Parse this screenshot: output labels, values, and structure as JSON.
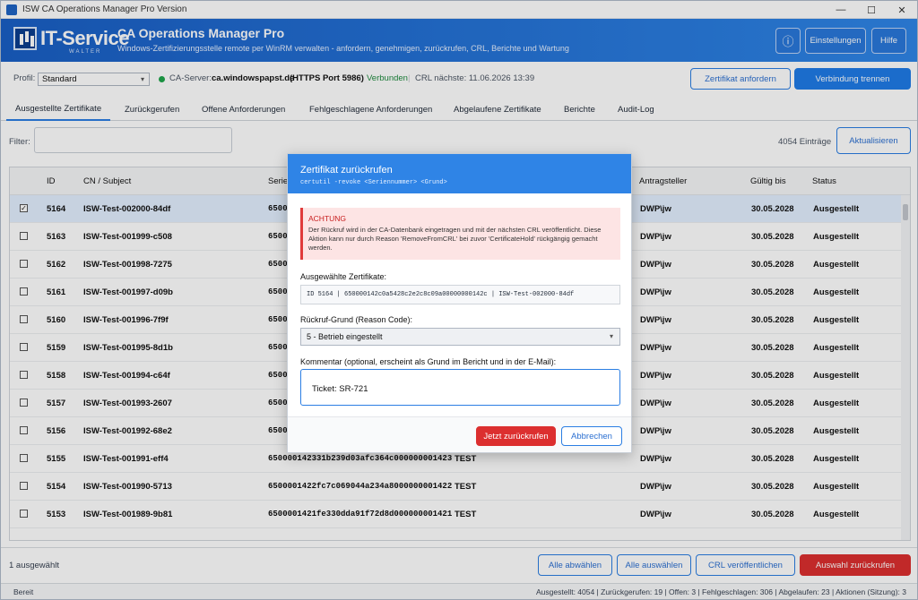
{
  "window": {
    "title": "ISW CA Operations Manager Pro Version",
    "min": "—",
    "max": "☐",
    "close": "✕"
  },
  "header": {
    "logo_text": "IT-Service",
    "logo_sub": "WALTER",
    "app_title": "CA Operations Manager Pro",
    "subtitle": "Windows-Zertifizierungsstelle remote per WinRM verwalten - anfordern, genehmigen, zurückrufen, CRL, Berichte und Wartung",
    "info_icon": "ⓘ",
    "settings_label": "Einstellungen",
    "help_label": "Hilfe"
  },
  "status": {
    "profile_label": "Profil:",
    "profile_value": "Standard",
    "ca_label": "CA-Server:",
    "ca_host": "ca.windowspapst.de",
    "ca_port": "(HTTPS Port 5986)",
    "connected": "Verbunden",
    "crl_next": "CRL nächste: 11.06.2026 13:39",
    "request_cert": "Zertifikat anfordern",
    "disconnect": "Verbindung trennen"
  },
  "tabs": [
    "Ausgestellte Zertifikate",
    "Zurückgerufen",
    "Offene Anforderungen",
    "Fehlgeschlagene Anforderungen",
    "Abgelaufene Zertifikate",
    "Berichte",
    "Audit-Log"
  ],
  "filter": {
    "label": "Filter:",
    "value": "",
    "count": "4054 Einträge",
    "refresh": "Aktualisieren"
  },
  "table": {
    "columns": [
      "ID",
      "CN / Subject",
      "Serie",
      "Antragsteller",
      "Gültig bis",
      "Status"
    ],
    "rows": [
      {
        "checked": "✓",
        "id": "5164",
        "cn": "ISW-Test-002000-84df",
        "serial": "65000",
        "template": "",
        "requester": "DWP\\jw",
        "valid": "30.05.2028",
        "status": "Ausgestellt"
      },
      {
        "checked": "",
        "id": "5163",
        "cn": "ISW-Test-001999-c508",
        "serial": "65000",
        "template": "",
        "requester": "DWP\\jw",
        "valid": "30.05.2028",
        "status": "Ausgestellt"
      },
      {
        "checked": "",
        "id": "5162",
        "cn": "ISW-Test-001998-7275",
        "serial": "65000",
        "template": "",
        "requester": "DWP\\jw",
        "valid": "30.05.2028",
        "status": "Ausgestellt"
      },
      {
        "checked": "",
        "id": "5161",
        "cn": "ISW-Test-001997-d09b",
        "serial": "65000",
        "template": "",
        "requester": "DWP\\jw",
        "valid": "30.05.2028",
        "status": "Ausgestellt"
      },
      {
        "checked": "",
        "id": "5160",
        "cn": "ISW-Test-001996-7f9f",
        "serial": "65000",
        "template": "",
        "requester": "DWP\\jw",
        "valid": "30.05.2028",
        "status": "Ausgestellt"
      },
      {
        "checked": "",
        "id": "5159",
        "cn": "ISW-Test-001995-8d1b",
        "serial": "65000",
        "template": "",
        "requester": "DWP\\jw",
        "valid": "30.05.2028",
        "status": "Ausgestellt"
      },
      {
        "checked": "",
        "id": "5158",
        "cn": "ISW-Test-001994-c64f",
        "serial": "65000",
        "template": "",
        "requester": "DWP\\jw",
        "valid": "30.05.2028",
        "status": "Ausgestellt"
      },
      {
        "checked": "",
        "id": "5157",
        "cn": "ISW-Test-001993-2607",
        "serial": "65000",
        "template": "",
        "requester": "DWP\\jw",
        "valid": "30.05.2028",
        "status": "Ausgestellt"
      },
      {
        "checked": "",
        "id": "5156",
        "cn": "ISW-Test-001992-68e2",
        "serial": "65000",
        "template": "",
        "requester": "DWP\\jw",
        "valid": "30.05.2028",
        "status": "Ausgestellt"
      },
      {
        "checked": "",
        "id": "5155",
        "cn": "ISW-Test-001991-eff4",
        "serial": "650000142331b239d03afc364c000000001423",
        "template": "TEST",
        "requester": "DWP\\jw",
        "valid": "30.05.2028",
        "status": "Ausgestellt"
      },
      {
        "checked": "",
        "id": "5154",
        "cn": "ISW-Test-001990-5713",
        "serial": "6500001422fc7c069044a234a8000000001422",
        "template": "TEST",
        "requester": "DWP\\jw",
        "valid": "30.05.2028",
        "status": "Ausgestellt"
      },
      {
        "checked": "",
        "id": "5153",
        "cn": "ISW-Test-001989-9b81",
        "serial": "6500001421fe330dda91f72d8d000000001421",
        "template": "TEST",
        "requester": "DWP\\jw",
        "valid": "30.05.2028",
        "status": "Ausgestellt"
      }
    ]
  },
  "footer": {
    "selected": "1 ausgewählt",
    "deselect_all": "Alle abwählen",
    "select_all": "Alle auswählen",
    "publish_crl": "CRL veröffentlichen",
    "revoke_selection": "Auswahl zurückrufen"
  },
  "statusbar": {
    "ready": "Bereit",
    "stats": "Ausgestellt: 4054  |  Zurückgerufen: 19  |  Offen: 3  |  Fehlgeschlagen: 306  |  Abgelaufen: 23  |  Aktionen (Sitzung): 3"
  },
  "dialog": {
    "title": "Zertifikat zurückrufen",
    "command": "certutil -revoke <Seriennummer> <Grund>",
    "warn_title": "ACHTUNG",
    "warn_text": "Der Rückruf wird in der CA-Datenbank eingetragen und mit der nächsten CRL veröffentlicht. Diese Aktion kann nur durch Reason 'RemoveFromCRL' bei zuvor 'CertificateHold' rückgängig gemacht werden.",
    "selected_label": "Ausgewählte Zertifikate:",
    "selected_value": "ID 5164  |  650000142c0a5428c2e2c8c09a00000000142c  |  ISW-Test-002000-84df",
    "reason_label": "Rückruf-Grund (Reason Code):",
    "reason_value": "5 - Betrieb eingestellt",
    "comment_label": "Kommentar (optional, erscheint als Grund im Bericht und in der E-Mail):",
    "comment_value": "Ticket: SR-721",
    "revoke_btn": "Jetzt zurückrufen",
    "cancel_btn": "Abbrechen"
  },
  "colors": {
    "brand": "#1f7ce8",
    "danger": "#dc2f2f",
    "success": "#1ea54a"
  }
}
